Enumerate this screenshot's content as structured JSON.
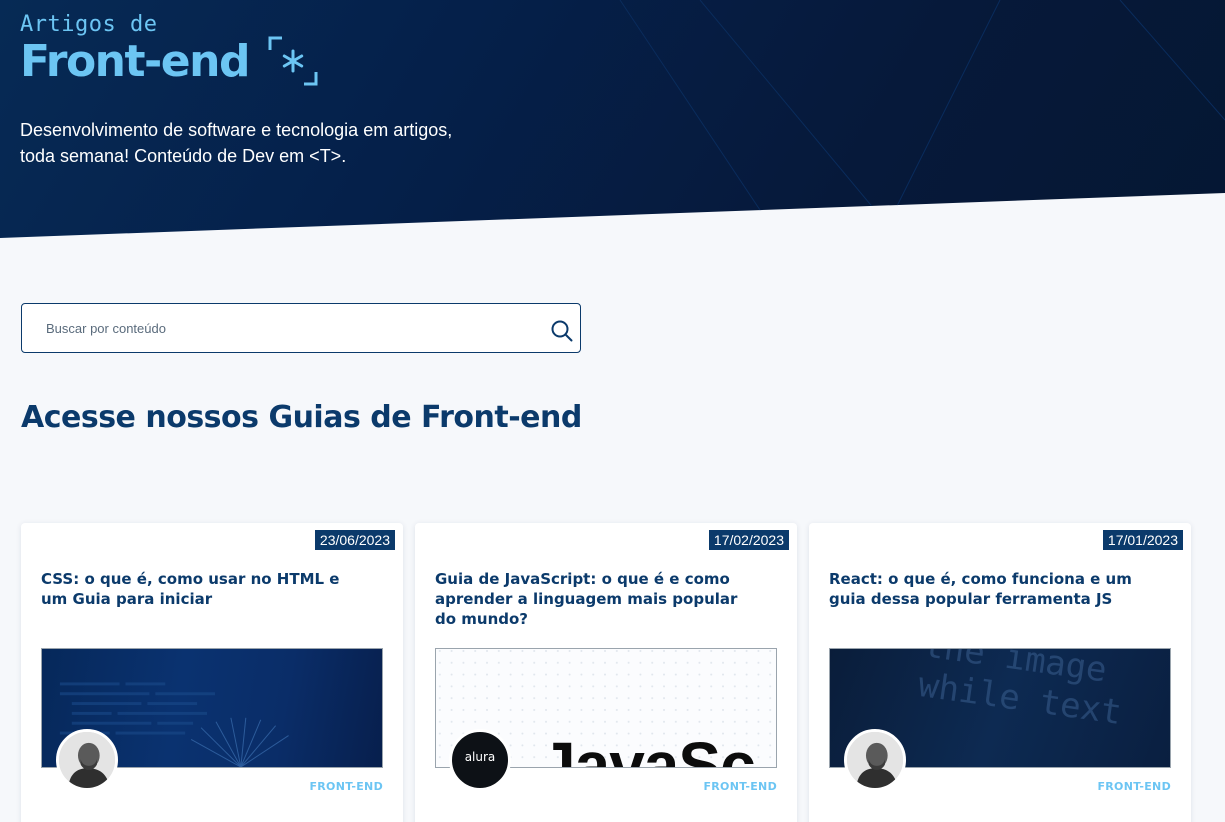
{
  "hero": {
    "eyebrow": "Artigos de",
    "title": "Front-end",
    "logo_icon": "brackets-asterisk-icon",
    "description_line1": "Desenvolvimento de software e tecnologia em artigos,",
    "description_line2": "toda semana! Conteúdo de Dev em <T>."
  },
  "search": {
    "placeholder": "Buscar por conteúdo",
    "value": "",
    "icon": "search-icon"
  },
  "section": {
    "title": "Acesse nossos Guias de Front-end"
  },
  "cards": [
    {
      "date": "23/06/2023",
      "title": "CSS: o que é, como usar no HTML e um Guia para iniciar",
      "tag": "FRONT-END",
      "image": "css-code-banner",
      "avatar": "author-avatar"
    },
    {
      "date": "17/02/2023",
      "title": "Guia de JavaScript: o que é e como aprender a linguagem mais popular do mundo?",
      "tag": "FRONT-END",
      "image": "javascript-banner",
      "image_text": "JavaSc",
      "avatar": "alura-logo",
      "avatar_text": "alura"
    },
    {
      "date": "17/01/2023",
      "title": "React: o que é, como funciona e um guia dessa popular ferramenta JS",
      "tag": "FRONT-END",
      "image": "react-code-banner",
      "image_text": "the image while text",
      "avatar": "author-avatar"
    }
  ],
  "colors": {
    "primary": "#0b3a6b",
    "accent": "#6cc5f3",
    "hero_bg": "#05204a",
    "page_bg": "#f6f8fb"
  }
}
